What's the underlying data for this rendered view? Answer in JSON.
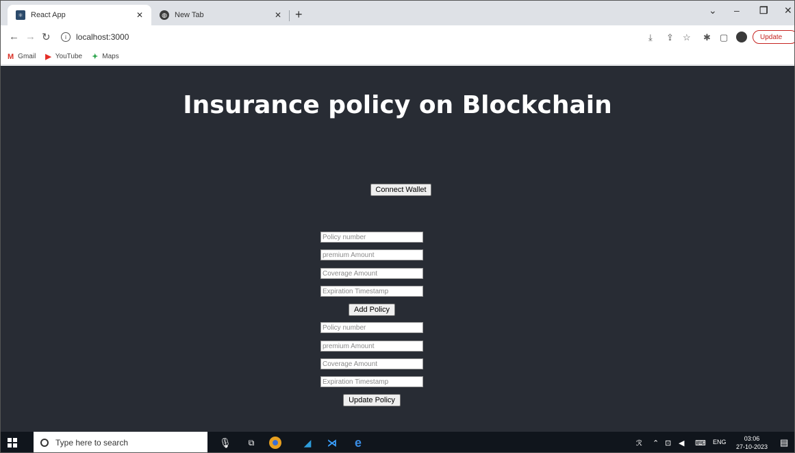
{
  "browser": {
    "tabs": [
      {
        "title": "React App",
        "favicon": "react-icon"
      },
      {
        "title": "New Tab",
        "favicon": "globe-icon"
      }
    ],
    "address": "localhost:3000",
    "update_label": "Update",
    "bookmarks": [
      {
        "label": "Gmail",
        "icon": "gmail-icon"
      },
      {
        "label": "YouTube",
        "icon": "youtube-icon"
      },
      {
        "label": "Maps",
        "icon": "maps-icon"
      }
    ]
  },
  "page": {
    "title": "Insurance policy on Blockchain",
    "connect_wallet_label": "Connect Wallet",
    "add_form": {
      "policy_number_placeholder": "Policy number",
      "premium_placeholder": "premium Amount",
      "coverage_placeholder": "Coverage Amount",
      "expiration_placeholder": "Expiration Timestamp",
      "submit_label": "Add Policy"
    },
    "update_form": {
      "policy_number_placeholder": "Policy number",
      "premium_placeholder": "premium Amount",
      "coverage_placeholder": "Coverage Amount",
      "expiration_placeholder": "Expiration Timestamp",
      "submit_label": "Update Policy"
    }
  },
  "taskbar": {
    "search_placeholder": "Type here to search",
    "language": "ENG",
    "time": "03:06",
    "date": "27-10-2023"
  }
}
